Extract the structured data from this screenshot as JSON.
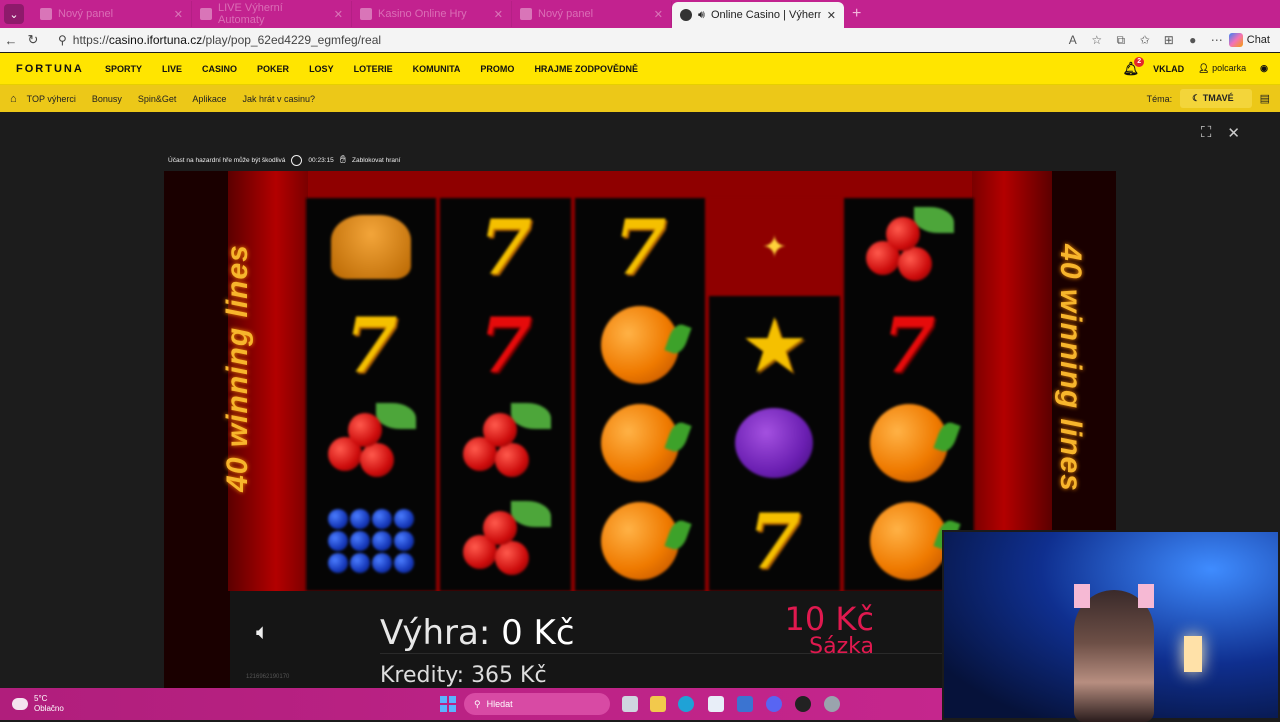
{
  "browser": {
    "tabs": [
      {
        "label": "Nový panel",
        "active": false
      },
      {
        "label": "LIVE Výherní Automaty",
        "active": false
      },
      {
        "label": "Kasino Online Hry",
        "active": false
      },
      {
        "label": "Nový panel",
        "active": false
      },
      {
        "label": "Online Casino | Výherní Autom",
        "active": true
      }
    ],
    "url_prefix": "https://",
    "url_host": "casino.ifortuna.cz",
    "url_path": "/play/pop_62ed4229_egmfeg/real",
    "read_aloud_icon": "A",
    "copilot_label": "Chat"
  },
  "site": {
    "logo": "FORTUNA",
    "main_nav": [
      "SPORTY",
      "LIVE",
      "CASINO",
      "POKER",
      "LOSY",
      "LOTERIE",
      "KOMUNITA",
      "PROMO",
      "HRAJME ZODPOVĚDNĚ"
    ],
    "notifications_count": "2",
    "deposit_label": "VKLAD",
    "username": "polcarka",
    "sub_nav": [
      "TOP výherci",
      "Bonusy",
      "Spin&Get",
      "Aplikace",
      "Jak hrát v casinu?"
    ],
    "theme_label": "Téma:",
    "theme_value": "TMAVÉ"
  },
  "game": {
    "warning": "Účast na hazardní hře může být škodlivá",
    "session_time": "00:23:15",
    "block_label": "Zablokovat hraní",
    "side_text_left": "40 winning lines",
    "side_text_right": "40 winning lines",
    "win_label": "Výhra:",
    "win_value": "0 Kč",
    "credits_label": "Kredity:",
    "credits_value": "365 Kč",
    "bet_value": "10 Kč",
    "bet_label": "Sázka",
    "serial": "1216962190170",
    "reels": [
      [
        "bell",
        "seven",
        "cherries",
        "grapes"
      ],
      [
        "seven",
        "seven-red",
        "cherries",
        "cherries"
      ],
      [
        "seven",
        "orange",
        "orange",
        "orange"
      ],
      [
        "special",
        "star",
        "plum",
        "seven"
      ],
      [
        "cherries",
        "seven-red",
        "orange",
        "orange"
      ]
    ]
  },
  "taskbar": {
    "temperature": "5°C",
    "weather": "Oblačno",
    "search_placeholder": "Hledat"
  },
  "colors": {
    "brand_yellow": "#ffe500",
    "tabbar": "#c2228f",
    "bet_color": "#e0194f"
  }
}
